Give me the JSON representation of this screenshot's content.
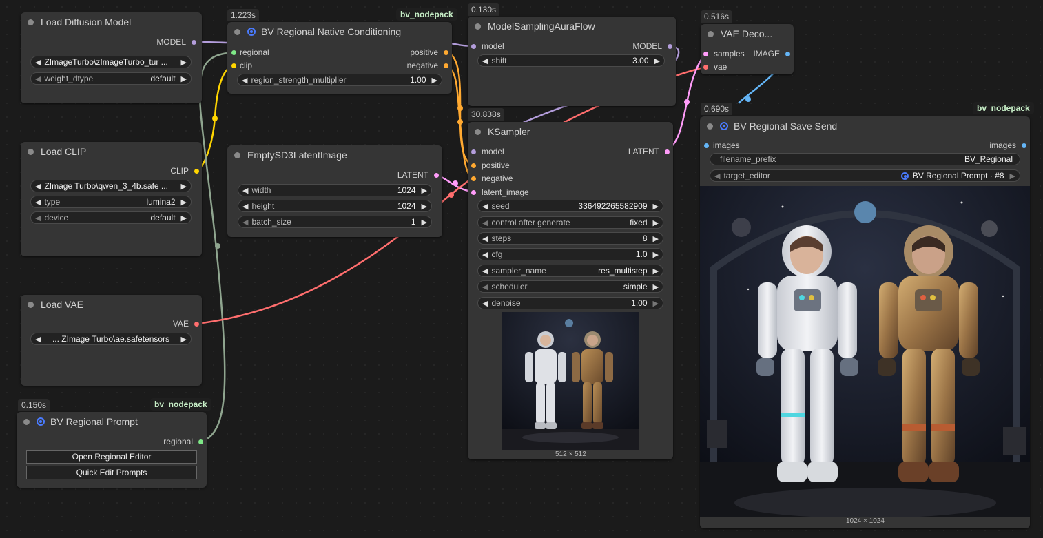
{
  "nodes": {
    "load_diffusion": {
      "title": "Load Diffusion Model",
      "output": "MODEL",
      "unet_name": "ZImageTurbo\\zImageTurbo_tur ...",
      "weight_dtype_label": "weight_dtype",
      "weight_dtype": "default"
    },
    "load_clip": {
      "title": "Load CLIP",
      "output": "CLIP",
      "clip_name": "ZImage Turbo\\qwen_3_4b.safe ...",
      "type_label": "type",
      "type": "lumina2",
      "device_label": "device",
      "device": "default"
    },
    "load_vae": {
      "title": "Load VAE",
      "output": "VAE",
      "vae_name": "... ZImage Turbo\\ae.safetensors"
    },
    "regional_prompt": {
      "time": "0.150s",
      "pack": "bv_nodepack",
      "title": "BV Regional Prompt",
      "output": "regional",
      "button_editor": "Open Regional Editor",
      "button_quick": "Quick Edit Prompts"
    },
    "native_cond": {
      "time": "1.223s",
      "pack": "bv_nodepack",
      "title": "BV Regional Native Conditioning",
      "in_regional": "regional",
      "in_clip": "clip",
      "out_positive": "positive",
      "out_negative": "negative",
      "strength_label": "region_strength_multiplier",
      "strength": "1.00"
    },
    "empty_latent": {
      "title": "EmptySD3LatentImage",
      "output": "LATENT",
      "width_label": "width",
      "width": "1024",
      "height_label": "height",
      "height": "1024",
      "batch_label": "batch_size",
      "batch": "1"
    },
    "model_sampling": {
      "time": "0.130s",
      "title": "ModelSamplingAuraFlow",
      "in_model": "model",
      "output": "MODEL",
      "shift_label": "shift",
      "shift": "3.00"
    },
    "ksampler": {
      "time": "30.838s",
      "title": "KSampler",
      "in_model": "model",
      "in_positive": "positive",
      "in_negative": "negative",
      "in_latent": "latent_image",
      "output": "LATENT",
      "seed_label": "seed",
      "seed": "336492265582909",
      "control_label": "control after generate",
      "control": "fixed",
      "steps_label": "steps",
      "steps": "8",
      "cfg_label": "cfg",
      "cfg": "1.0",
      "sampler_label": "sampler_name",
      "sampler": "res_multistep",
      "scheduler_label": "scheduler",
      "scheduler": "simple",
      "denoise_label": "denoise",
      "denoise": "1.00",
      "preview_size": "512 × 512"
    },
    "vae_decode": {
      "time": "0.516s",
      "title": "VAE Deco...",
      "in_samples": "samples",
      "in_vae": "vae",
      "output": "IMAGE"
    },
    "save_send": {
      "time": "0.690s",
      "pack": "bv_nodepack",
      "title": "BV Regional Save Send",
      "in_images": "images",
      "out_images": "images",
      "prefix_label": "filename_prefix",
      "prefix": "BV_Regional",
      "target_label": "target_editor",
      "target": "BV Regional Prompt · #8",
      "preview_size": "1024 × 1024"
    }
  },
  "colors": {
    "model": "#b39ddb",
    "clip": "#ffd500",
    "vae": "#ff6e6e",
    "latent": "#ff9cf9",
    "conditioning": "#ffa931",
    "image": "#64b5f6",
    "regional": "#7ee787",
    "regional_wire": "#8fa58f"
  },
  "icons": {
    "pack_logo": "swirl-logo-icon",
    "arrow_left": "arrow-left-icon",
    "arrow_right": "arrow-right-icon"
  }
}
